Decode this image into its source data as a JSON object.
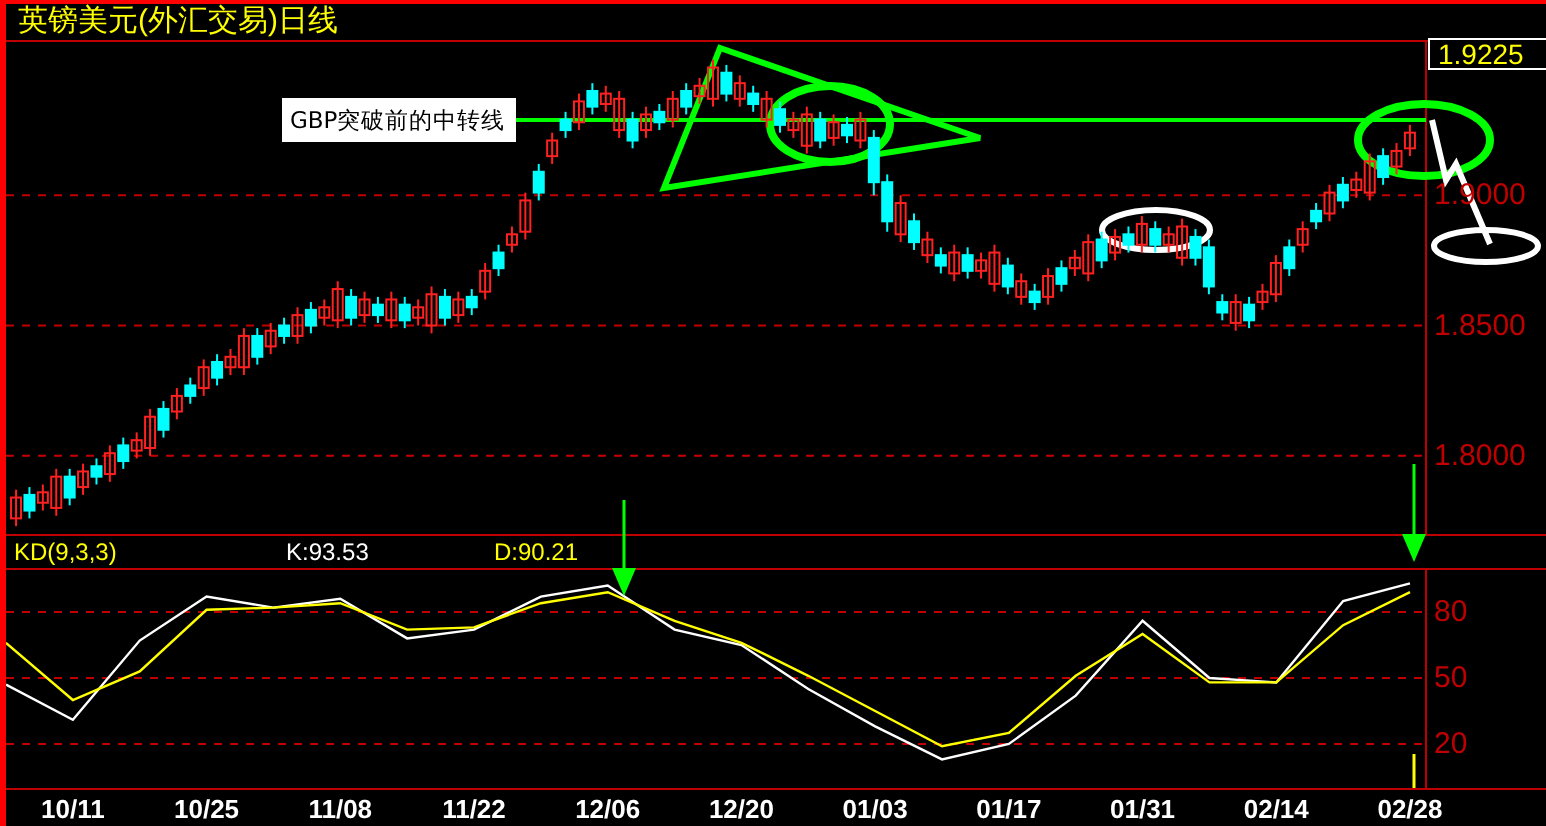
{
  "title": "英镑美元(外汇交易)日线",
  "price_panel": {
    "last_price": "1.9225",
    "annotation_label": "GBP突破前的中转线",
    "chart_data": {
      "type": "candlestick",
      "grid": true,
      "categories": [
        null,
        null,
        null,
        null,
        null,
        null,
        null,
        null,
        null,
        null,
        null,
        null,
        null,
        null,
        null,
        null,
        null,
        null,
        null,
        null,
        null,
        null,
        null,
        null,
        null,
        null,
        null,
        null,
        null,
        null,
        null,
        null,
        null,
        null,
        null,
        null,
        null,
        null,
        null,
        null,
        null,
        null,
        null,
        null,
        null,
        null,
        null,
        null,
        null,
        null,
        null,
        null,
        null,
        null,
        null,
        null,
        null,
        null,
        null,
        null,
        null,
        null,
        null,
        null,
        null,
        null,
        null,
        null,
        null,
        null,
        null,
        null,
        null,
        null,
        null,
        null,
        null,
        null,
        null,
        null,
        null,
        null,
        null,
        null,
        null,
        null,
        null,
        null,
        null,
        null,
        null,
        null,
        null,
        null,
        null,
        null,
        null,
        null,
        null,
        null,
        null,
        null,
        null,
        null,
        null
      ],
      "ohlc": [
        [
          1.776,
          1.787,
          1.773,
          1.784
        ],
        [
          1.785,
          1.788,
          1.776,
          1.779
        ],
        [
          1.782,
          1.789,
          1.779,
          1.786
        ],
        [
          1.78,
          1.795,
          1.777,
          1.792
        ],
        [
          1.792,
          1.795,
          1.781,
          1.784
        ],
        [
          1.788,
          1.797,
          1.785,
          1.794
        ],
        [
          1.796,
          1.799,
          1.789,
          1.792
        ],
        [
          1.793,
          1.804,
          1.79,
          1.801
        ],
        [
          1.804,
          1.807,
          1.795,
          1.798
        ],
        [
          1.802,
          1.809,
          1.799,
          1.806
        ],
        [
          1.803,
          1.818,
          1.8,
          1.815
        ],
        [
          1.818,
          1.821,
          1.807,
          1.81
        ],
        [
          1.817,
          1.826,
          1.814,
          1.823
        ],
        [
          1.827,
          1.83,
          1.82,
          1.823
        ],
        [
          1.826,
          1.837,
          1.823,
          1.834
        ],
        [
          1.836,
          1.839,
          1.827,
          1.83
        ],
        [
          1.834,
          1.841,
          1.831,
          1.838
        ],
        [
          1.834,
          1.849,
          1.831,
          1.846
        ],
        [
          1.846,
          1.849,
          1.835,
          1.838
        ],
        [
          1.842,
          1.851,
          1.839,
          1.848
        ],
        [
          1.85,
          1.853,
          1.843,
          1.846
        ],
        [
          1.846,
          1.857,
          1.843,
          1.854
        ],
        [
          1.856,
          1.859,
          1.847,
          1.85
        ],
        [
          1.853,
          1.86,
          1.85,
          1.857
        ],
        [
          1.852,
          1.867,
          1.849,
          1.864
        ],
        [
          1.861,
          1.864,
          1.85,
          1.853
        ],
        [
          1.854,
          1.863,
          1.851,
          1.86
        ],
        [
          1.858,
          1.861,
          1.851,
          1.854
        ],
        [
          1.852,
          1.863,
          1.849,
          1.86
        ],
        [
          1.858,
          1.861,
          1.849,
          1.852
        ],
        [
          1.853,
          1.86,
          1.85,
          1.857
        ],
        [
          1.85,
          1.865,
          1.847,
          1.862
        ],
        [
          1.861,
          1.864,
          1.85,
          1.853
        ],
        [
          1.854,
          1.863,
          1.851,
          1.86
        ],
        [
          1.861,
          1.864,
          1.854,
          1.857
        ],
        [
          1.863,
          1.874,
          1.86,
          1.871
        ],
        [
          1.878,
          1.881,
          1.869,
          1.872
        ],
        [
          1.881,
          1.888,
          1.878,
          1.885
        ],
        [
          1.886,
          1.901,
          1.883,
          1.898
        ],
        [
          1.909,
          1.912,
          1.898,
          1.901
        ],
        [
          1.915,
          1.924,
          1.912,
          1.921
        ],
        [
          1.929,
          1.932,
          1.922,
          1.925
        ],
        [
          1.928,
          1.939,
          1.925,
          1.936
        ],
        [
          1.94,
          1.943,
          1.931,
          1.934
        ],
        [
          1.935,
          1.942,
          1.932,
          1.939
        ],
        [
          1.925,
          1.94,
          1.922,
          1.937
        ],
        [
          1.929,
          1.932,
          1.918,
          1.921
        ],
        [
          1.925,
          1.934,
          1.922,
          1.931
        ],
        [
          1.932,
          1.935,
          1.925,
          1.928
        ],
        [
          1.929,
          1.94,
          1.926,
          1.937
        ],
        [
          1.94,
          1.943,
          1.931,
          1.934
        ],
        [
          1.938,
          1.945,
          1.935,
          1.942
        ],
        [
          1.937,
          1.952,
          1.934,
          1.949
        ],
        [
          1.947,
          1.95,
          1.936,
          1.939
        ],
        [
          1.937,
          1.946,
          1.934,
          1.943
        ],
        [
          1.939,
          1.942,
          1.932,
          1.935
        ],
        [
          1.929,
          1.94,
          1.926,
          1.937
        ],
        [
          1.933,
          1.936,
          1.924,
          1.927
        ],
        [
          1.925,
          1.932,
          1.922,
          1.929
        ],
        [
          1.919,
          1.934,
          1.916,
          1.931
        ],
        [
          1.929,
          1.932,
          1.918,
          1.921
        ],
        [
          1.922,
          1.931,
          1.919,
          1.928
        ],
        [
          1.927,
          1.93,
          1.92,
          1.923
        ],
        [
          1.921,
          1.932,
          1.918,
          1.929
        ],
        [
          1.922,
          1.925,
          1.9,
          1.905
        ],
        [
          1.905,
          1.908,
          1.886,
          1.89
        ],
        [
          1.885,
          1.9,
          1.882,
          1.897
        ],
        [
          1.89,
          1.893,
          1.879,
          1.882
        ],
        [
          1.877,
          1.886,
          1.874,
          1.883
        ],
        [
          1.877,
          1.88,
          1.87,
          1.873
        ],
        [
          1.87,
          1.881,
          1.867,
          1.878
        ],
        [
          1.877,
          1.88,
          1.868,
          1.871
        ],
        [
          1.871,
          1.878,
          1.868,
          1.875
        ],
        [
          1.866,
          1.881,
          1.863,
          1.878
        ],
        [
          1.873,
          1.876,
          1.862,
          1.865
        ],
        [
          1.861,
          1.87,
          1.858,
          1.867
        ],
        [
          1.863,
          1.866,
          1.856,
          1.859
        ],
        [
          1.861,
          1.872,
          1.858,
          1.869
        ],
        [
          1.872,
          1.875,
          1.863,
          1.866
        ],
        [
          1.872,
          1.879,
          1.869,
          1.876
        ],
        [
          1.87,
          1.885,
          1.867,
          1.882
        ],
        [
          1.883,
          1.886,
          1.872,
          1.875
        ],
        [
          1.878,
          1.887,
          1.875,
          1.884
        ],
        [
          1.885,
          1.888,
          1.878,
          1.881
        ],
        [
          1.881,
          1.892,
          1.878,
          1.889
        ],
        [
          1.887,
          1.89,
          1.878,
          1.881
        ],
        [
          1.881,
          1.888,
          1.878,
          1.885
        ],
        [
          1.876,
          1.891,
          1.873,
          1.888
        ],
        [
          1.884,
          1.887,
          1.873,
          1.876
        ],
        [
          1.88,
          1.883,
          1.862,
          1.865
        ],
        [
          1.859,
          1.862,
          1.852,
          1.855
        ],
        [
          1.851,
          1.862,
          1.848,
          1.859
        ],
        [
          1.858,
          1.861,
          1.849,
          1.852
        ],
        [
          1.859,
          1.866,
          1.856,
          1.863
        ],
        [
          1.862,
          1.877,
          1.859,
          1.874
        ],
        [
          1.88,
          1.883,
          1.869,
          1.872
        ],
        [
          1.881,
          1.89,
          1.878,
          1.887
        ],
        [
          1.894,
          1.897,
          1.887,
          1.89
        ],
        [
          1.893,
          1.904,
          1.89,
          1.901
        ],
        [
          1.904,
          1.907,
          1.895,
          1.898
        ],
        [
          1.902,
          1.909,
          1.899,
          1.906
        ],
        [
          1.901,
          1.916,
          1.898,
          1.913
        ],
        [
          1.915,
          1.918,
          1.904,
          1.907
        ],
        [
          1.911,
          1.92,
          1.908,
          1.917
        ],
        [
          1.918,
          1.927,
          1.915,
          1.924
        ]
      ],
      "ylim": [
        1.77,
        1.9588
      ],
      "yticks": [
        {
          "value": 1.9,
          "label": "1.9000"
        },
        {
          "value": 1.85,
          "label": "1.8500"
        },
        {
          "value": 1.8,
          "label": "1.8000"
        }
      ]
    }
  },
  "kd_panel": {
    "name": "KD(9,3,3)",
    "k_reading": "K:93.53",
    "d_reading": "D:90.21",
    "chart_data": {
      "type": "line",
      "grid": true,
      "categories": [
        null,
        "10/11",
        null,
        "10/25",
        null,
        "11/08",
        null,
        "11/22",
        null,
        "12/06",
        null,
        "12/20",
        null,
        "01/03",
        null,
        "01/17",
        null,
        "01/31",
        null,
        "02/14",
        null,
        "02/28"
      ],
      "series": [
        {
          "color": "#ffffff",
          "values": [
            47,
            31,
            67,
            87,
            82,
            86,
            68,
            72,
            87,
            92,
            72,
            65,
            45,
            28,
            13,
            20,
            42,
            76,
            50,
            48,
            85,
            93
          ]
        },
        {
          "color": "#ffff00",
          "values": [
            66,
            40,
            53,
            81,
            82,
            84,
            72,
            73,
            84,
            89,
            76,
            66,
            51,
            35,
            19,
            25,
            51,
            70,
            48,
            48,
            74,
            89
          ]
        }
      ],
      "ylim": [
        0,
        100
      ],
      "yticks": [
        20,
        50,
        80
      ]
    }
  }
}
